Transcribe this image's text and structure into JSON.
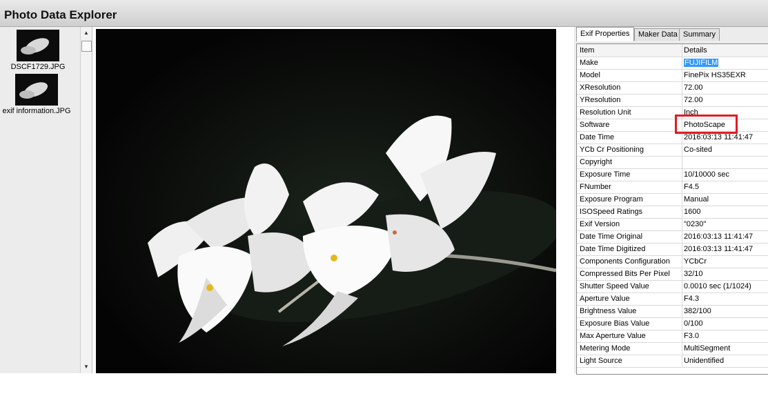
{
  "window": {
    "title": "Photo Data Explorer"
  },
  "thumbnails": [
    {
      "filename": "DSCF1729.JPG"
    },
    {
      "filename": "exif information.JPG"
    }
  ],
  "tabs": [
    {
      "label": "Exif Properties",
      "active": true
    },
    {
      "label": "Maker Data",
      "active": false
    },
    {
      "label": "Summary",
      "active": false
    }
  ],
  "table": {
    "headers": {
      "item": "Item",
      "details": "Details"
    },
    "rows": [
      {
        "item": "Make",
        "details": "FUJIFILM"
      },
      {
        "item": "Model",
        "details": "FinePix HS35EXR"
      },
      {
        "item": "XResolution",
        "details": "72.00"
      },
      {
        "item": "YResolution",
        "details": "72.00"
      },
      {
        "item": "Resolution Unit",
        "details": "Inch"
      },
      {
        "item": "Software",
        "details": "PhotoScape"
      },
      {
        "item": "Date Time",
        "details": "2016:03:13 11:41:47"
      },
      {
        "item": "YCb Cr Positioning",
        "details": "Co-sited"
      },
      {
        "item": "Copyright",
        "details": ""
      },
      {
        "item": "Exposure Time",
        "details": "10/10000 sec"
      },
      {
        "item": "FNumber",
        "details": "F4.5"
      },
      {
        "item": "Exposure Program",
        "details": "Manual"
      },
      {
        "item": "ISOSpeed Ratings",
        "details": "1600"
      },
      {
        "item": "Exif Version",
        "details": "\"0230\""
      },
      {
        "item": "Date Time Original",
        "details": "2016:03:13 11:41:47"
      },
      {
        "item": "Date Time Digitized",
        "details": "2016:03:13 11:41:47"
      },
      {
        "item": "Components Configuration",
        "details": "YCbCr"
      },
      {
        "item": "Compressed Bits Per Pixel",
        "details": "32/10"
      },
      {
        "item": "Shutter Speed Value",
        "details": "0.0010 sec (1/1024)"
      },
      {
        "item": "Aperture Value",
        "details": "F4.3"
      },
      {
        "item": "Brightness Value",
        "details": "382/100"
      },
      {
        "item": "Exposure Bias Value",
        "details": "0/100"
      },
      {
        "item": "Max Aperture Value",
        "details": "F3.0"
      },
      {
        "item": "Metering Mode",
        "details": "MultiSegment"
      },
      {
        "item": "Light Source",
        "details": "Unidentified"
      }
    ]
  },
  "colors": {
    "highlight": "#e01b24",
    "selection": "#3399ff"
  }
}
